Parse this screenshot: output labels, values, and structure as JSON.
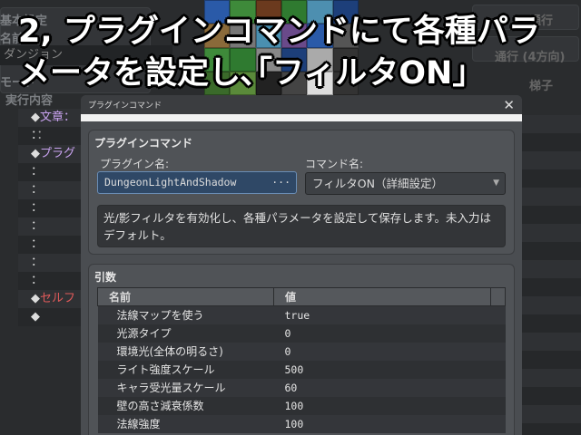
{
  "caption": {
    "line1": "2, プラグインコマンドにて各種パラ",
    "line2": "メータを設定し､｢フィルタON｣"
  },
  "background": {
    "left_labels": {
      "basic": "基本設定",
      "name": "名前",
      "name_value": "ダンジョン",
      "mode": "モード",
      "contents": "実行内容"
    },
    "right_labels": {
      "pass": "通行",
      "pass4": "通行 (4方向)",
      "ladder": "梯子"
    },
    "event_list": [
      {
        "marker": "◆",
        "text": "文章：",
        "color": "#c9a3f0"
      },
      {
        "marker": "：",
        "text": "：",
        "color": "#aaa"
      },
      {
        "marker": "◆",
        "text": "プラグ",
        "color": "#c9a3f0"
      },
      {
        "marker": "：",
        "text": "",
        "color": "#aaa"
      },
      {
        "marker": "：",
        "text": "",
        "color": "#aaa"
      },
      {
        "marker": "：",
        "text": "",
        "color": "#aaa"
      },
      {
        "marker": "：",
        "text": "",
        "color": "#aaa"
      },
      {
        "marker": "：",
        "text": "",
        "color": "#aaa"
      },
      {
        "marker": "：",
        "text": "",
        "color": "#aaa"
      },
      {
        "marker": "：",
        "text": "",
        "color": "#aaa"
      },
      {
        "marker": "◆",
        "text": "セルフ",
        "color": "#e05a5a"
      },
      {
        "marker": "◆",
        "text": "",
        "color": "#aaa"
      }
    ]
  },
  "dialog": {
    "title": "プラグインコマンド",
    "close": "✕",
    "group1": {
      "title": "プラグインコマンド",
      "plugin_label": "プラグイン名:",
      "plugin_value": "DungeonLightAndShadow",
      "plugin_button": "···",
      "command_label": "コマンド名:",
      "command_value": "フィルタON（詳細設定）",
      "command_arrow": "▼",
      "description": "光/影フィルタを有効化し、各種パラメータを設定して保存します。未入力はデフォルト。"
    },
    "group2": {
      "title": "引数",
      "headers": [
        "名前",
        "値"
      ],
      "rows": [
        {
          "name": "法線マップを使う",
          "value": "true"
        },
        {
          "name": "光源タイプ",
          "value": "0"
        },
        {
          "name": "環境光(全体の明るさ)",
          "value": "0"
        },
        {
          "name": "ライト強度スケール",
          "value": "500"
        },
        {
          "name": "キャラ受光量スケール",
          "value": "60"
        },
        {
          "name": "壁の高さ減衰係数",
          "value": "100"
        },
        {
          "name": "法線強度",
          "value": "100"
        }
      ]
    }
  }
}
